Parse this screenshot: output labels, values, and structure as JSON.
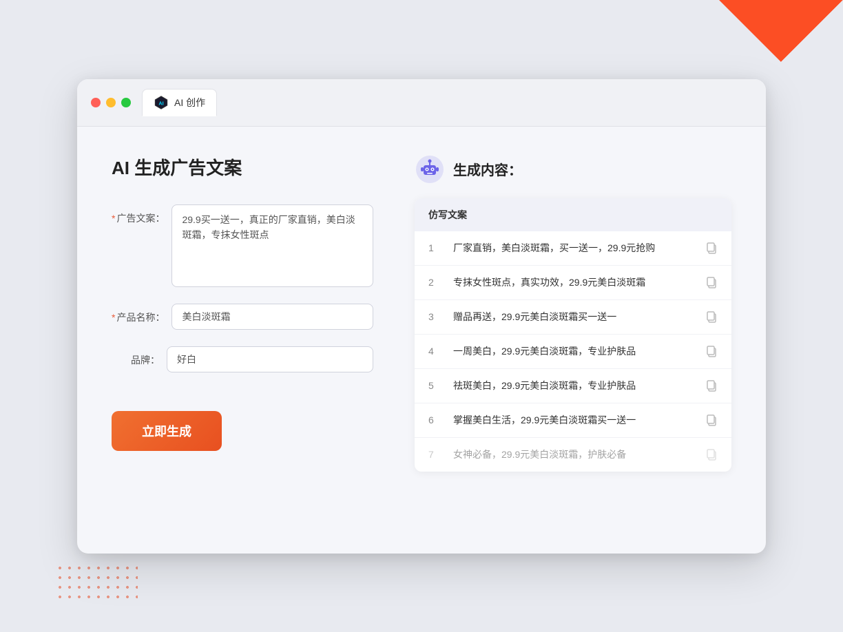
{
  "window": {
    "controls": {
      "close": "close",
      "minimize": "minimize",
      "maximize": "maximize"
    },
    "tab": {
      "label": "AI 创作"
    }
  },
  "left_panel": {
    "title": "AI 生成广告文案",
    "form": {
      "ad_copy_label": "广告文案：",
      "ad_copy_required": "*",
      "ad_copy_value": "29.9买一送一，真正的厂家直销，美白淡斑霜，专抹女性斑点",
      "product_name_label": "产品名称：",
      "product_name_required": "*",
      "product_name_value": "美白淡斑霜",
      "brand_label": "品牌：",
      "brand_value": "好白"
    },
    "generate_button": "立即生成"
  },
  "right_panel": {
    "title": "生成内容：",
    "table_header": "仿写文案",
    "results": [
      {
        "id": 1,
        "text": "厂家直销，美白淡斑霜，买一送一，29.9元抢购"
      },
      {
        "id": 2,
        "text": "专抹女性斑点，真实功效，29.9元美白淡斑霜"
      },
      {
        "id": 3,
        "text": "赠品再送，29.9元美白淡斑霜买一送一"
      },
      {
        "id": 4,
        "text": "一周美白，29.9元美白淡斑霜，专业护肤品"
      },
      {
        "id": 5,
        "text": "祛斑美白，29.9元美白淡斑霜，专业护肤品"
      },
      {
        "id": 6,
        "text": "掌握美白生活，29.9元美白淡斑霜买一送一"
      },
      {
        "id": 7,
        "text": "女神必备，29.9元美白淡斑霜，护肤必备",
        "faded": true
      }
    ]
  }
}
